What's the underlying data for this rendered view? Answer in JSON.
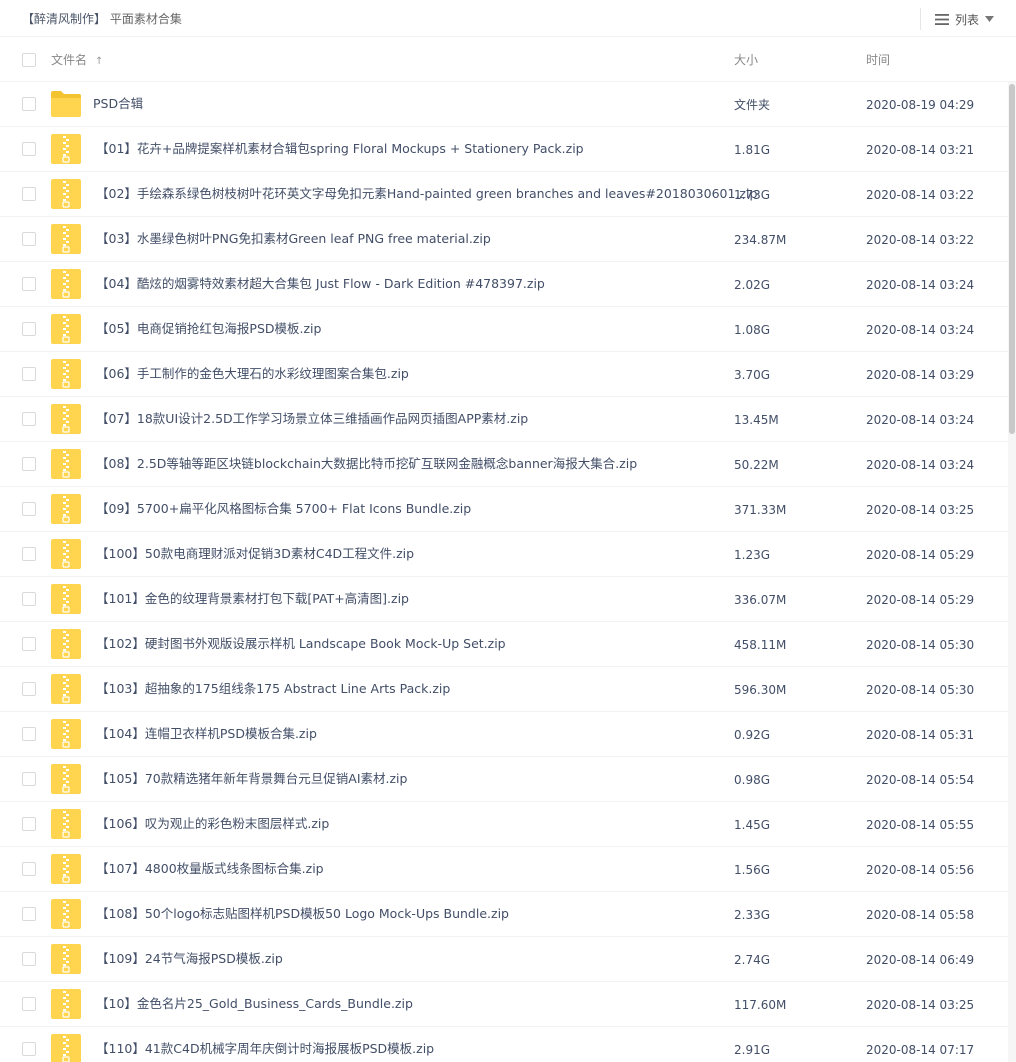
{
  "breadcrumb": {
    "parent": "【醉清风制作】",
    "current": "平面素材合集"
  },
  "view_toggle": {
    "label": "列表",
    "icon": "list-icon"
  },
  "columns": {
    "name": "文件名",
    "size": "大小",
    "time": "时间",
    "sort_indicator": "↑"
  },
  "colors": {
    "folder": "#ffd54f",
    "zip": "#ffd54f",
    "zipper": "#ffffff"
  },
  "files": [
    {
      "name": "PSD合辑",
      "size": "文件夹",
      "time": "2020-08-19 04:29",
      "type": "folder"
    },
    {
      "name": "【01】花卉+品牌提案样机素材合辑包spring Floral Mockups + Stationery Pack.zip",
      "size": "1.81G",
      "time": "2020-08-14 03:21",
      "type": "zip"
    },
    {
      "name": "【02】手绘森系绿色树枝树叶花环英文字母免扣元素Hand-painted green branches and leaves#2018030601.zip",
      "size": "1.73G",
      "time": "2020-08-14 03:22",
      "type": "zip"
    },
    {
      "name": "【03】水墨绿色树叶PNG免扣素材Green leaf PNG free material.zip",
      "size": "234.87M",
      "time": "2020-08-14 03:22",
      "type": "zip"
    },
    {
      "name": "【04】酷炫的烟雾特效素材超大合集包 Just Flow - Dark Edition #478397.zip",
      "size": "2.02G",
      "time": "2020-08-14 03:24",
      "type": "zip"
    },
    {
      "name": "【05】电商促销抢红包海报PSD模板.zip",
      "size": "1.08G",
      "time": "2020-08-14 03:24",
      "type": "zip"
    },
    {
      "name": "【06】手工制作的金色大理石的水彩纹理图案合集包.zip",
      "size": "3.70G",
      "time": "2020-08-14 03:29",
      "type": "zip"
    },
    {
      "name": "【07】18款UI设计2.5D工作学习场景立体三维插画作品网页插图APP素材.zip",
      "size": "13.45M",
      "time": "2020-08-14 03:24",
      "type": "zip"
    },
    {
      "name": "【08】2.5D等轴等距区块链blockchain大数据比特币挖矿互联网金融概念banner海报大集合.zip",
      "size": "50.22M",
      "time": "2020-08-14 03:24",
      "type": "zip"
    },
    {
      "name": "【09】5700+扁平化风格图标合集 5700+ Flat Icons Bundle.zip",
      "size": "371.33M",
      "time": "2020-08-14 03:25",
      "type": "zip"
    },
    {
      "name": "【100】50款电商理财派对促销3D素材C4D工程文件.zip",
      "size": "1.23G",
      "time": "2020-08-14 05:29",
      "type": "zip"
    },
    {
      "name": "【101】金色的纹理背景素材打包下载[PAT+高清图].zip",
      "size": "336.07M",
      "time": "2020-08-14 05:29",
      "type": "zip"
    },
    {
      "name": "【102】硬封图书外观版设展示样机 Landscape Book Mock-Up Set.zip",
      "size": "458.11M",
      "time": "2020-08-14 05:30",
      "type": "zip"
    },
    {
      "name": "【103】超抽象的175组线条175 Abstract Line Arts Pack.zip",
      "size": "596.30M",
      "time": "2020-08-14 05:30",
      "type": "zip"
    },
    {
      "name": "【104】连帽卫衣样机PSD模板合集.zip",
      "size": "0.92G",
      "time": "2020-08-14 05:31",
      "type": "zip"
    },
    {
      "name": "【105】70款精选猪年新年背景舞台元旦促销AI素材.zip",
      "size": "0.98G",
      "time": "2020-08-14 05:54",
      "type": "zip"
    },
    {
      "name": "【106】叹为观止的彩色粉末图层样式.zip",
      "size": "1.45G",
      "time": "2020-08-14 05:55",
      "type": "zip"
    },
    {
      "name": "【107】4800枚量版式线条图标合集.zip",
      "size": "1.56G",
      "time": "2020-08-14 05:56",
      "type": "zip"
    },
    {
      "name": "【108】50个logo标志贴图样机PSD模板50 Logo Mock-Ups Bundle.zip",
      "size": "2.33G",
      "time": "2020-08-14 05:58",
      "type": "zip"
    },
    {
      "name": "【109】24节气海报PSD模板.zip",
      "size": "2.74G",
      "time": "2020-08-14 06:49",
      "type": "zip"
    },
    {
      "name": "【10】金色名片25_Gold_Business_Cards_Bundle.zip",
      "size": "117.60M",
      "time": "2020-08-14 03:25",
      "type": "zip"
    },
    {
      "name": "【110】41款C4D机械字周年庆倒计时海报展板PSD模板.zip",
      "size": "2.91G",
      "time": "2020-08-14 07:17",
      "type": "zip"
    }
  ]
}
